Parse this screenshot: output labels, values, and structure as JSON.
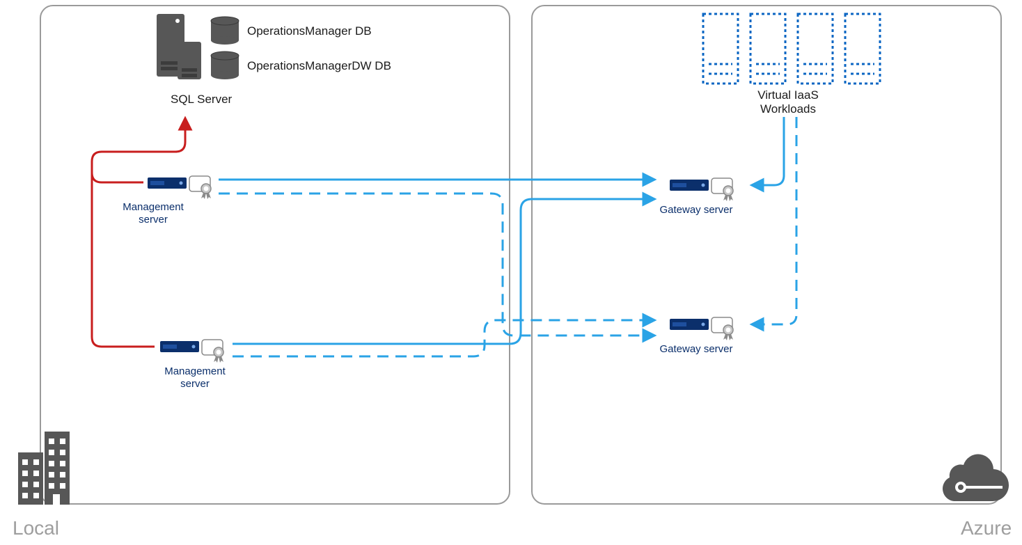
{
  "regions": {
    "local_label": "Local",
    "azure_label": "Azure"
  },
  "sql": {
    "caption": "SQL Server",
    "db1_label": "OperationsManager DB",
    "db2_label": "OperationsManagerDW DB"
  },
  "mgmt1": {
    "label_l1": "Management",
    "label_l2": "server"
  },
  "mgmt2": {
    "label_l1": "Management",
    "label_l2": "server"
  },
  "gw1": {
    "label": "Gateway server"
  },
  "gw2": {
    "label": "Gateway server"
  },
  "vms": {
    "label_l1": "Virtual IaaS",
    "label_l2": "Workloads"
  },
  "colors": {
    "blue": "#2aa3e6",
    "navy": "#0b2f6b",
    "red": "#c81e1e",
    "grey": "#575757",
    "panel_border": "#9a9a9a"
  }
}
